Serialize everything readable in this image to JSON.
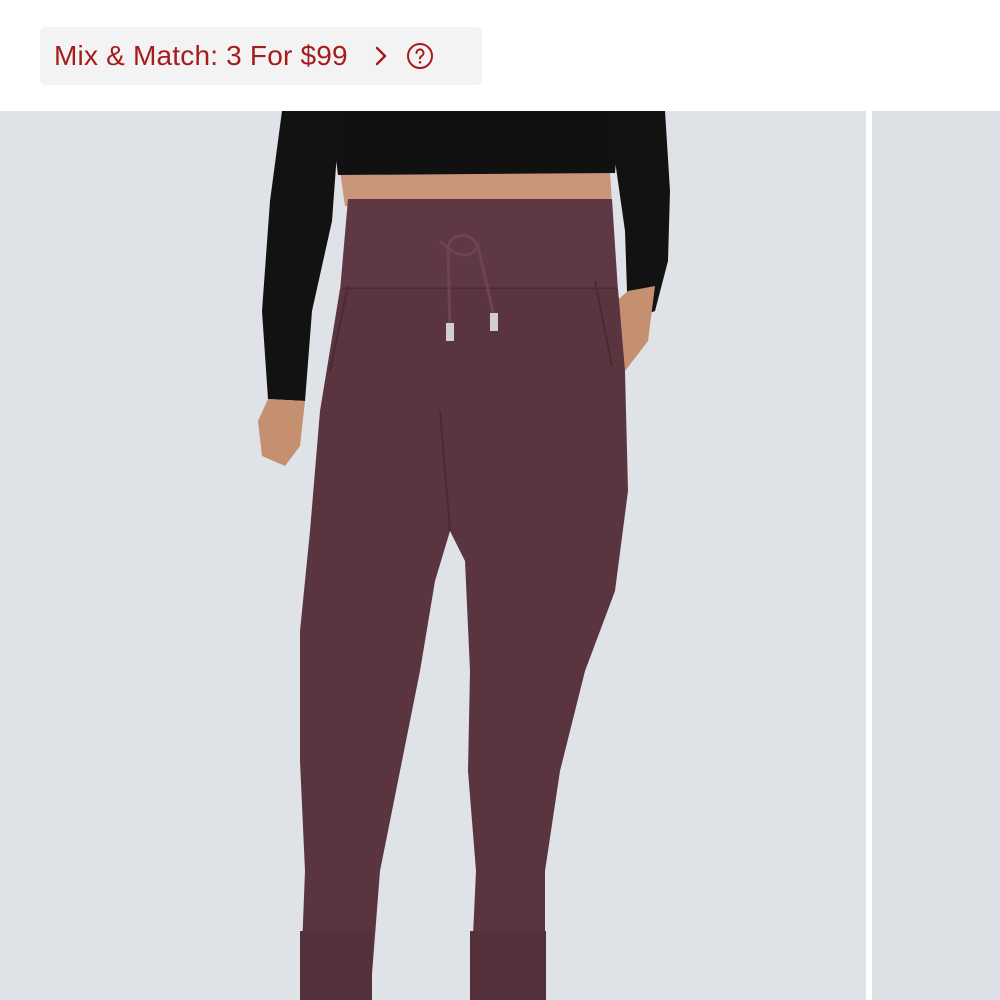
{
  "promo": {
    "label": "Mix & Match: 3 For $99",
    "chevron_icon": "chevron-right-icon",
    "help_icon": "question-circle-icon",
    "text_color": "#a51c1c",
    "background_color": "#f3f3f3"
  },
  "gallery": {
    "main_image": {
      "subject": "product-photo",
      "background_color": "#dfe2e6",
      "garment_color": "#5a3540"
    },
    "next_image": {
      "background_color": "#dde0e4"
    }
  }
}
